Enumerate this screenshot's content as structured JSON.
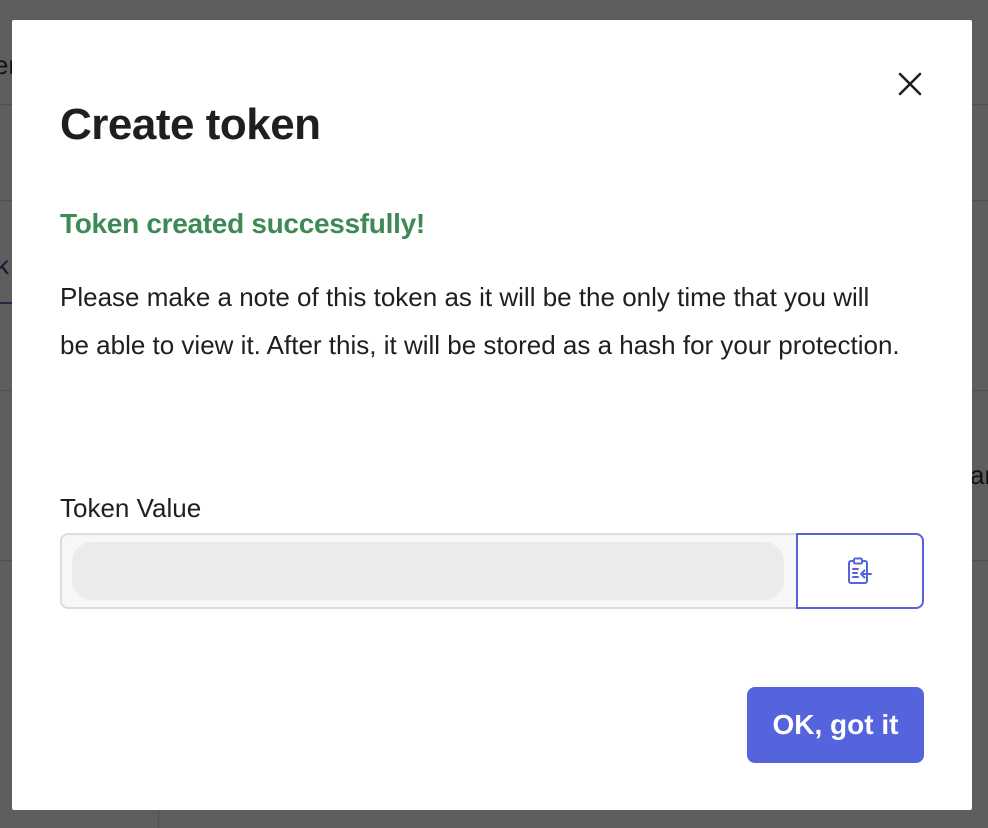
{
  "modal": {
    "title": "Create token",
    "success_message": "Token created successfully!",
    "note": "Please make a note of this token as it will be the only time that you will be able to view it. After this, it will be stored as a hash for your protection.",
    "token_label": "Token Value",
    "token_value": "",
    "copy_icon": "clipboard-copy-icon",
    "close_icon": "close-icon",
    "confirm_label": "OK, got it"
  },
  "colors": {
    "accent": "#5563dc",
    "success": "#3d8a55",
    "text": "#1f1f1f"
  }
}
